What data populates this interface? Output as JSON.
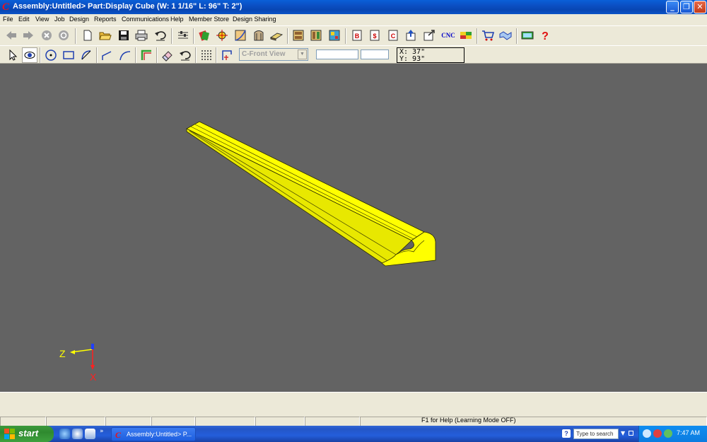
{
  "window": {
    "title": "Assembly:Untitled> Part:Display Cube (W: 1 1/16\" L: 96\" T: 2\")",
    "logo_glyph": "C",
    "minimize": "_",
    "maximize": "❐",
    "close": "✕"
  },
  "menu": [
    "File",
    "Edit",
    "View",
    "Job",
    "Design",
    "Reports",
    "Communications",
    "Help",
    "Member Store",
    "Design Sharing"
  ],
  "toolbar2": {
    "view_select": "C-Front View",
    "coord_x": "X: 37\"",
    "coord_y": "Y: 93\""
  },
  "toolbar1": {
    "cnc_label": "CNC"
  },
  "viewport": {
    "background": "#636363",
    "part_color": "#ffff00",
    "axis_z_label": "Z",
    "axis_x_label": "X"
  },
  "status": {
    "help_text": "F1 for Help (Learning Mode OFF)"
  },
  "taskbar": {
    "start_label": "start",
    "task_label": "Assembly:Untitled> P...",
    "search_placeholder": "Type to search",
    "time": "7:47 AM"
  }
}
